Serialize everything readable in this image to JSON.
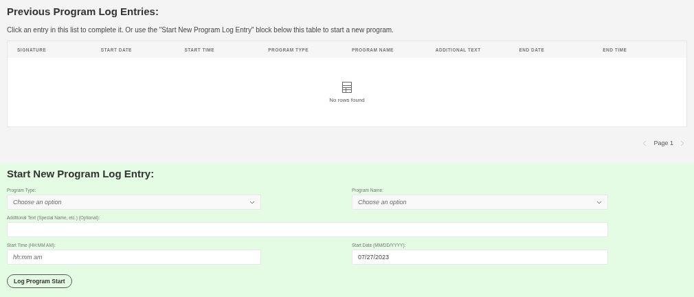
{
  "previous": {
    "heading": "Previous Program Log Entries:",
    "description": "Click an entry in this list to complete it. Or use the \"Start New Program Log Entry\" block below this table to start a new program.",
    "table": {
      "columns": [
        "SIGNATURE",
        "START DATE",
        "START TIME",
        "PROGRAM TYPE",
        "PROGRAM NAME",
        "ADDITIONAL TEXT",
        "END DATE",
        "END TIME"
      ],
      "empty_message": "No rows found"
    },
    "pager": {
      "label": "Page 1",
      "prev_disabled": true,
      "next_disabled": true
    }
  },
  "new_entry": {
    "heading": "Start New Program Log Entry:",
    "fields": [
      {
        "kind": "select",
        "label": "Program Type:",
        "placeholder": "Choose an option",
        "span": false
      },
      {
        "kind": "select",
        "label": "Program Name:",
        "placeholder": "Choose an option",
        "span": false
      },
      {
        "kind": "text",
        "label": "Additional Text (Special Name, etc.) (Optional):",
        "span": true
      },
      {
        "kind": "text",
        "label": "Start Time (HH:MM AM):",
        "placeholder": "hh:mm am",
        "span": false
      },
      {
        "kind": "text",
        "label": "Start Date (MM/DD/YYYY):",
        "value": "07/27/2023",
        "span": false
      }
    ],
    "submit": "Log Program Start"
  }
}
